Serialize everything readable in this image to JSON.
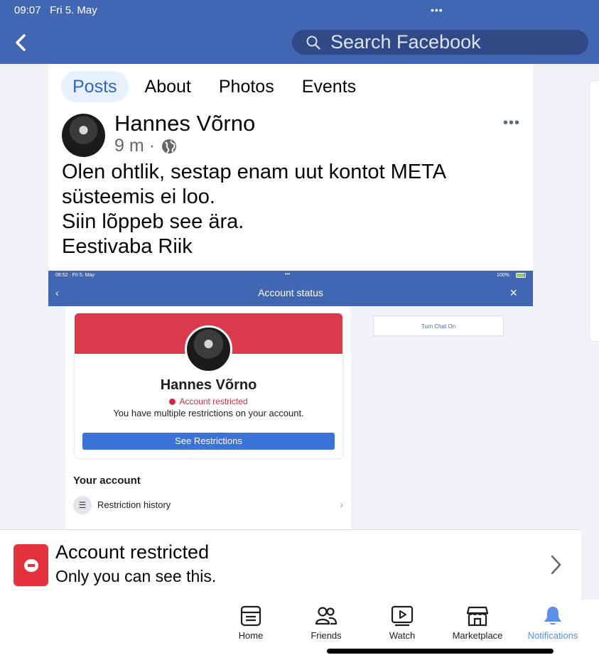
{
  "status": {
    "time": "09:07",
    "date": "Fri 5. May",
    "dots": "•••"
  },
  "search": {
    "placeholder": "Search Facebook"
  },
  "tabs": [
    {
      "label": "Posts",
      "active": true
    },
    {
      "label": "About"
    },
    {
      "label": "Photos"
    },
    {
      "label": "Events"
    }
  ],
  "post": {
    "author": "Hannes Võrno",
    "time": "9 m",
    "separator": "·",
    "more": "•••",
    "lines": [
      "Olen ohtlik, sestap enam uut kontot META",
      "süsteemis ei loo.",
      "Siin lõppeb see ära.",
      "Eestivaba Riik"
    ]
  },
  "embedded": {
    "status_left": "08:52 · Fri 5. May",
    "status_dots": "•••",
    "status_battery": "100%",
    "header_title": "Account status",
    "name": "Hannes Võrno",
    "status_text": "Account restricted",
    "description": "You have multiple restrictions on your account.",
    "button": "See Restrictions",
    "section_title": "Your account",
    "row_label": "Restriction history",
    "chat_button": "Turn Chat On"
  },
  "notice": {
    "title": "Account restricted",
    "subtitle": "Only you can see this."
  },
  "bottom_nav": [
    {
      "label": "Home",
      "icon": "home-icon"
    },
    {
      "label": "Friends",
      "icon": "friends-icon"
    },
    {
      "label": "Watch",
      "icon": "watch-icon"
    },
    {
      "label": "Marketplace",
      "icon": "marketplace-icon"
    },
    {
      "label": "Notifications",
      "icon": "bell-icon",
      "active": true
    }
  ],
  "colors": {
    "brand_blue": "#4267b2",
    "active_tab": "#2d66c9",
    "restricted_red": "#e4333f",
    "notifications_active": "#5d8ee8"
  }
}
